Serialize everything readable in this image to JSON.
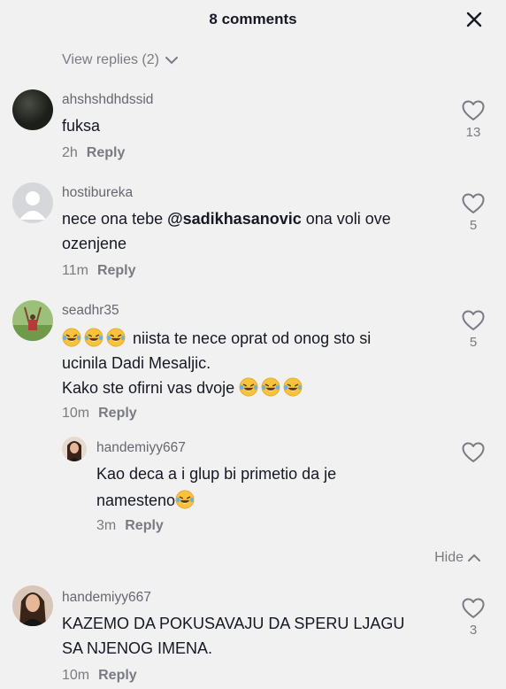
{
  "header": {
    "title": "8 comments",
    "close_icon": "close-icon"
  },
  "view_replies": {
    "label": "View replies (2)",
    "icon": "chevron-down-icon"
  },
  "comments": [
    {
      "username": "ahshshdhdssid",
      "text": "fuksa",
      "time": "2h",
      "reply": "Reply",
      "likes": "13"
    },
    {
      "username": "hostibureka",
      "text_prefix": "nece ona tebe ",
      "mention": "@sadikhasanovic",
      "text_suffix": " ona voli ove",
      "text_line2": "ozenjene",
      "time": "11m",
      "reply": "Reply",
      "likes": "5"
    },
    {
      "username": "seadhr35",
      "text_line1": "niista te nece oprat od onog sto si",
      "text_line2": "ucinila Dadi Mesaljic.",
      "text_line3": "Kako ste ofirni vas dvoje",
      "time": "10m",
      "reply": "Reply",
      "likes": "5"
    },
    {
      "username": "handemiyy667",
      "text_line1": "Kao deca a i glup bi primetio da je",
      "text_line2": "namesteno",
      "time": "3m",
      "reply": "Reply"
    },
    {
      "username": "handemiyy667",
      "text_line1": "KAZEMO DA POKUSAVAJU DA SPERU LJAGU",
      "text_line2": "SA NJENOG IMENA.",
      "time": "10m",
      "reply": "Reply",
      "likes": "3"
    }
  ],
  "hide": {
    "label": "Hide",
    "icon": "chevron-up-icon"
  },
  "emoji": "laughing-tears-emoji",
  "colors": {
    "background": "#f1f1f2",
    "text": "#161823",
    "muted": "#7a7b82"
  }
}
